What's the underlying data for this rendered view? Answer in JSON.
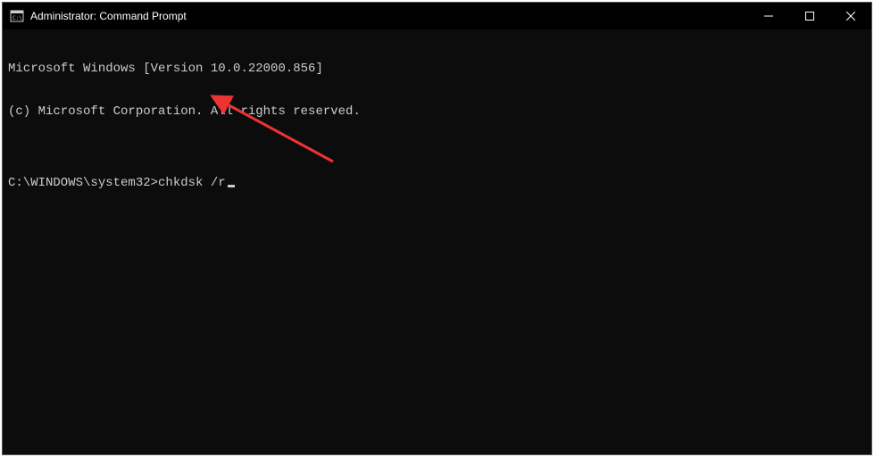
{
  "window": {
    "title": "Administrator: Command Prompt"
  },
  "terminal": {
    "line1": "Microsoft Windows [Version 10.0.22000.856]",
    "line2": "(c) Microsoft Corporation. All rights reserved.",
    "blank": "",
    "prompt": "C:\\WINDOWS\\system32>",
    "command": "chkdsk /r"
  },
  "annotation": {
    "arrow_color": "#ee3333"
  }
}
